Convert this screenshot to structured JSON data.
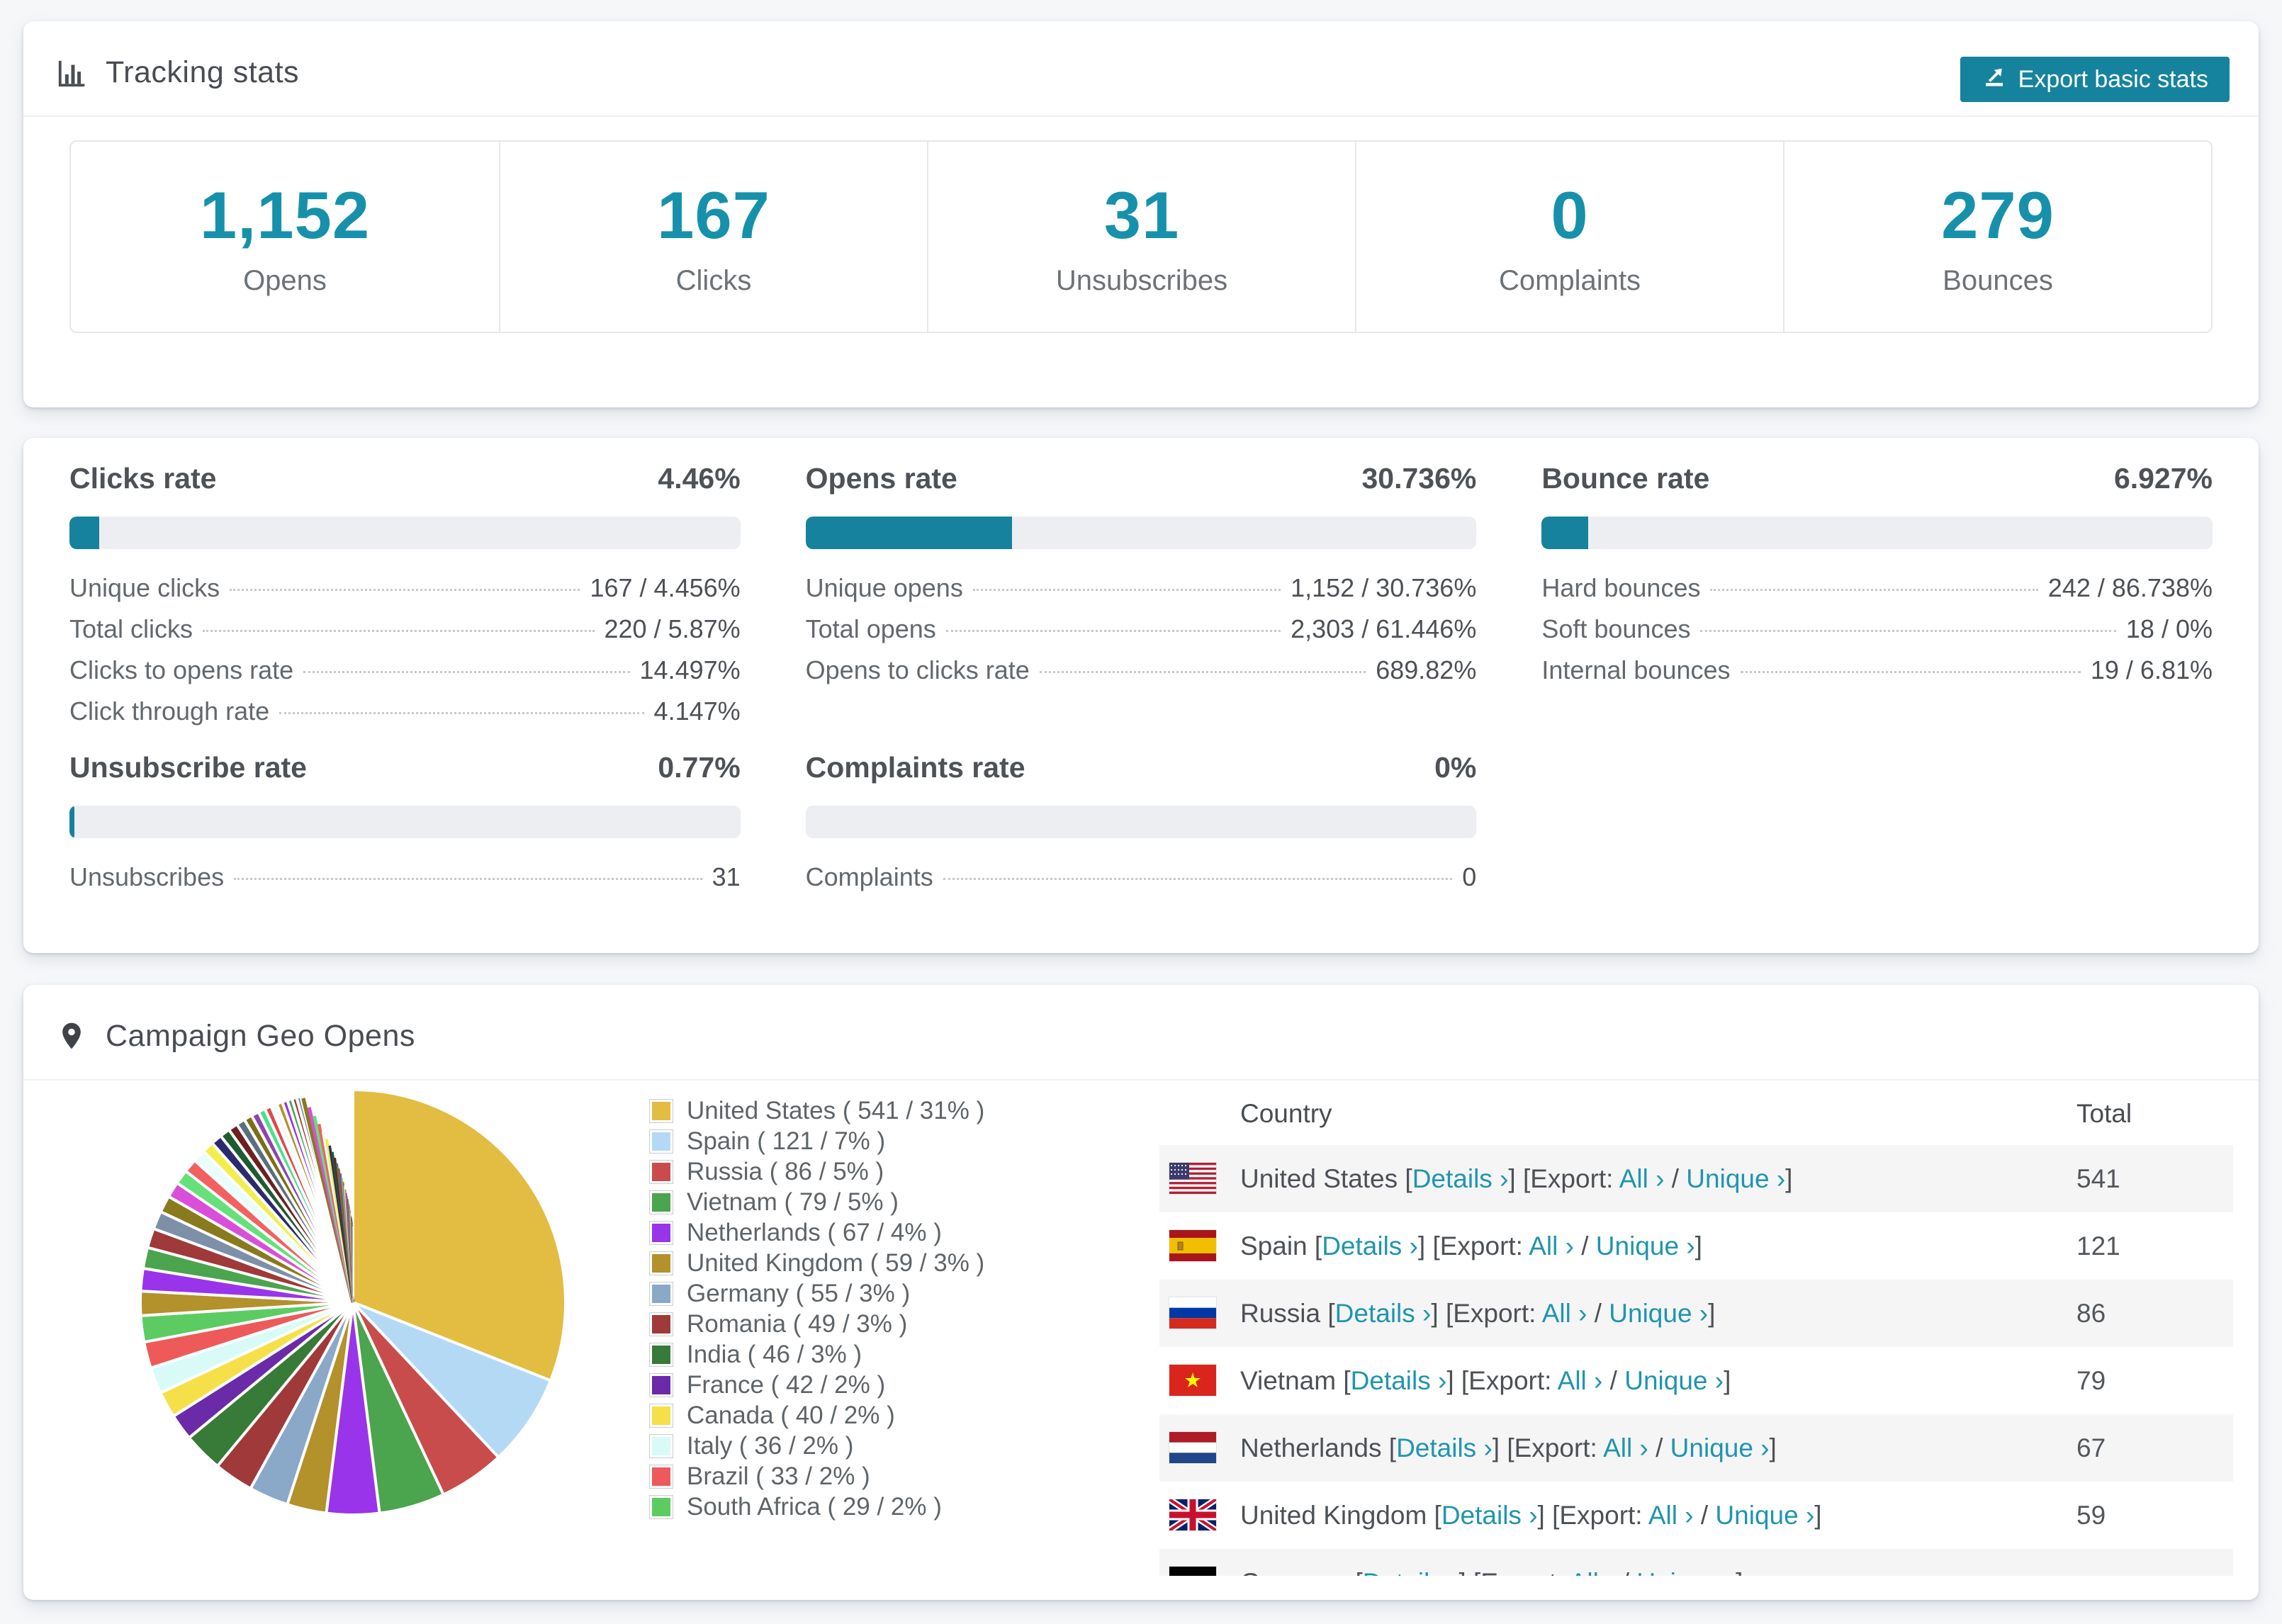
{
  "theme": {
    "teal_button": "#15839e",
    "teal_number": "#1791ab",
    "teal_link": "#2095ae",
    "bar_fill": "#16829e",
    "bar_track": "#eceef1",
    "page_bg": "#f6f7f9",
    "row_stripe": "#f5f5f6"
  },
  "tracking": {
    "icon": "bar-chart-icon",
    "title": "Tracking stats",
    "export_button": "Export basic stats",
    "stats": [
      {
        "value": "1,152",
        "label": "Opens"
      },
      {
        "value": "167",
        "label": "Clicks"
      },
      {
        "value": "31",
        "label": "Unsubscribes"
      },
      {
        "value": "0",
        "label": "Complaints"
      },
      {
        "value": "279",
        "label": "Bounces"
      }
    ]
  },
  "rates": {
    "panels": [
      {
        "title": "Clicks rate",
        "value": "4.46%",
        "pct": 4.46,
        "rows": [
          {
            "label": "Unique clicks",
            "value": "167 / 4.456%"
          },
          {
            "label": "Total clicks",
            "value": "220 / 5.87%"
          },
          {
            "label": "Clicks to opens rate",
            "value": "14.497%"
          },
          {
            "label": "Click through rate",
            "value": "4.147%"
          }
        ]
      },
      {
        "title": "Opens rate",
        "value": "30.736%",
        "pct": 30.736,
        "rows": [
          {
            "label": "Unique opens",
            "value": "1,152 / 30.736%"
          },
          {
            "label": "Total opens",
            "value": "2,303 / 61.446%"
          },
          {
            "label": "Opens to clicks rate",
            "value": "689.82%"
          }
        ]
      },
      {
        "title": "Bounce rate",
        "value": "6.927%",
        "pct": 6.927,
        "rows": [
          {
            "label": "Hard bounces",
            "value": "242 / 86.738%"
          },
          {
            "label": "Soft bounces",
            "value": "18 / 0%"
          },
          {
            "label": "Internal bounces",
            "value": "19 / 6.81%"
          }
        ]
      },
      {
        "title": "Unsubscribe rate",
        "value": "0.77%",
        "pct": 0.77,
        "rows": [
          {
            "label": "Unsubscribes",
            "value": "31"
          }
        ]
      },
      {
        "title": "Complaints rate",
        "value": "0%",
        "pct": 0,
        "rows": [
          {
            "label": "Complaints",
            "value": "0"
          }
        ]
      }
    ]
  },
  "geo": {
    "icon": "location-pin-icon",
    "title": "Campaign Geo Opens",
    "table": {
      "headers": [
        "Country",
        "Total"
      ],
      "details_link": "Details ›",
      "export_prefix": "[Export:",
      "all_link": "All ›",
      "unique_link": "Unique ›",
      "rows": [
        {
          "country": "United States",
          "flag": "us",
          "total": "541"
        },
        {
          "country": "Spain",
          "flag": "es",
          "total": "121"
        },
        {
          "country": "Russia",
          "flag": "ru",
          "total": "86"
        },
        {
          "country": "Vietnam",
          "flag": "vn",
          "total": "79"
        },
        {
          "country": "Netherlands",
          "flag": "nl",
          "total": "67"
        },
        {
          "country": "United Kingdom",
          "flag": "gb",
          "total": "59"
        },
        {
          "country": "Germany",
          "flag": "de",
          "total": "",
          "partial": true
        }
      ]
    }
  },
  "chart_data": {
    "type": "pie",
    "title": "Campaign Geo Opens",
    "legend_position": "right",
    "start_angle_deg": -90,
    "direction": "clockwise",
    "slices": [
      {
        "label": "United States",
        "value": 541,
        "pct": 31,
        "color": "#e3bc42"
      },
      {
        "label": "Spain",
        "value": 121,
        "pct": 7,
        "color": "#b4d9f5"
      },
      {
        "label": "Russia",
        "value": 86,
        "pct": 5,
        "color": "#c94c4c"
      },
      {
        "label": "Vietnam",
        "value": 79,
        "pct": 5,
        "color": "#4ba44e"
      },
      {
        "label": "Netherlands",
        "value": 67,
        "pct": 4,
        "color": "#9934ea"
      },
      {
        "label": "United Kingdom",
        "value": 59,
        "pct": 3,
        "color": "#b3912b"
      },
      {
        "label": "Germany",
        "value": 55,
        "pct": 3,
        "color": "#8aa8c8"
      },
      {
        "label": "Romania",
        "value": 49,
        "pct": 3,
        "color": "#a03939"
      },
      {
        "label": "India",
        "value": 46,
        "pct": 3,
        "color": "#387a38"
      },
      {
        "label": "France",
        "value": 42,
        "pct": 2,
        "color": "#6b2ba8"
      },
      {
        "label": "Canada",
        "value": 40,
        "pct": 2,
        "color": "#f5e049"
      },
      {
        "label": "Italy",
        "value": 36,
        "pct": 2,
        "color": "#d8fbf7"
      },
      {
        "label": "Brazil",
        "value": 33,
        "pct": 2,
        "color": "#ee5a5a"
      },
      {
        "label": "South Africa",
        "value": 29,
        "pct": 2,
        "color": "#5ccc62"
      }
    ],
    "other_slices": {
      "note": "long tail of small unlabeled country slices",
      "approx_total_pct": 26,
      "palette": [
        "#b3912b",
        "#9934ea",
        "#4ba44e",
        "#a03939",
        "#7d90a8",
        "#8a7a1e",
        "#d94fd9",
        "#66e07a",
        "#f26060",
        "#e8fdfc",
        "#f2ee4e",
        "#2c2a6e",
        "#1e5c30",
        "#6e1f1f",
        "#5a6e7e",
        "#7a6e16",
        "#8e44ad",
        "#4be08a",
        "#e04848",
        "#eef8ff"
      ]
    }
  }
}
